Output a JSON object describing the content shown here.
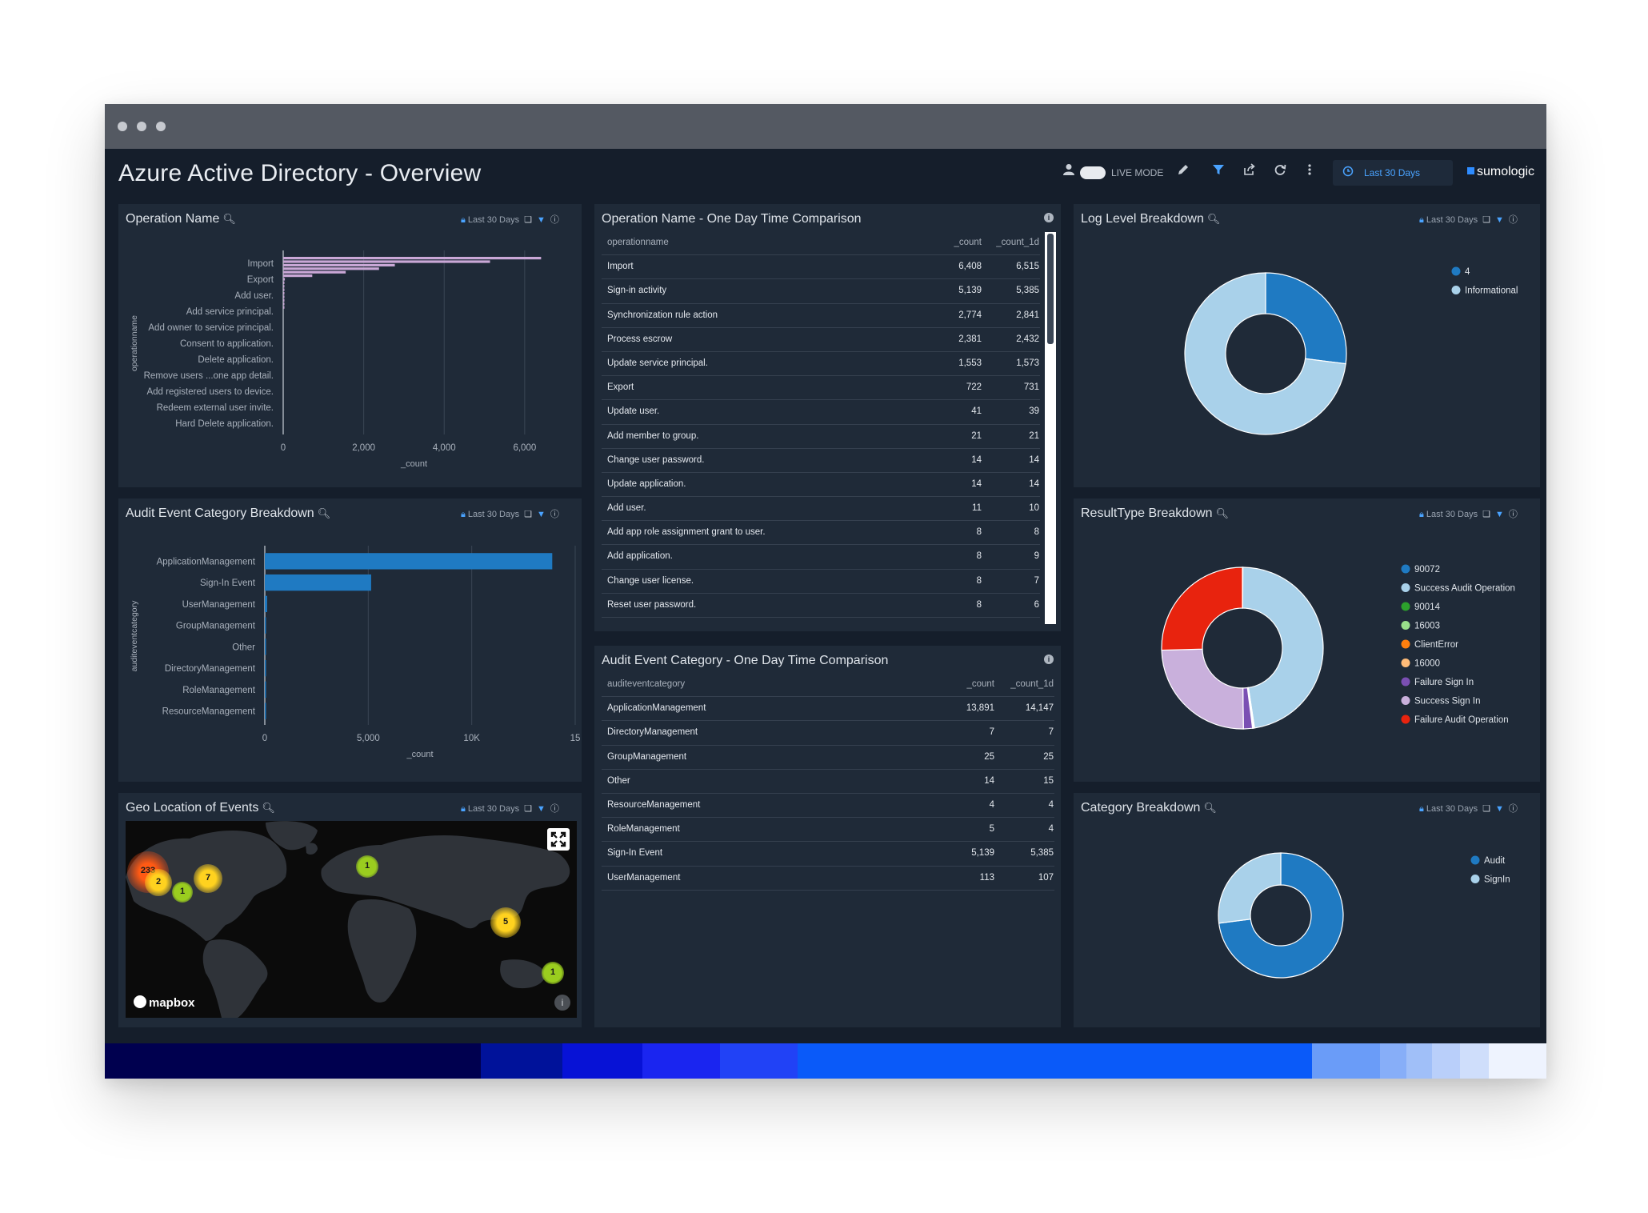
{
  "header": {
    "title": "Azure Active Directory - Overview",
    "live_mode_label": "LIVE MODE",
    "time_range": "Last 30 Days",
    "brand": "sumologic"
  },
  "panels": {
    "operation_name": {
      "title": "Operation Name",
      "time_range": "Last 30 Days",
      "chart_data": {
        "type": "bar",
        "orientation": "horizontal",
        "categories": [
          "Import",
          "Export",
          "Add user.",
          "Add service principal.",
          "Add owner to service principal.",
          "Consent to application.",
          "Delete application.",
          "Remove users ...one app detail.",
          "Add registered users to device.",
          "Redeem external user invite.",
          "Hard Delete application."
        ],
        "xlabel": "_count",
        "ylabel": "operationname",
        "xticks": [
          "0",
          "2,000",
          "4,000",
          "6,000"
        ],
        "xlim": [
          0,
          6500
        ],
        "bar_values": [
          6408,
          5139,
          2774,
          2381,
          1553,
          722,
          41,
          21,
          14,
          14,
          11,
          8,
          8,
          8,
          8
        ]
      }
    },
    "audit_category": {
      "title": "Audit Event Category Breakdown",
      "time_range": "Last 30 Days",
      "chart_data": {
        "type": "bar",
        "orientation": "horizontal",
        "categories": [
          "ApplicationManagement",
          "Sign-In Event",
          "UserManagement",
          "GroupManagement",
          "Other",
          "DirectoryManagement",
          "RoleManagement",
          "ResourceManagement"
        ],
        "values": [
          13891,
          5139,
          113,
          25,
          14,
          7,
          5,
          4
        ],
        "xlabel": "_count",
        "ylabel": "auditeventcategory",
        "xticks": [
          "0",
          "5,000",
          "10K",
          "15"
        ],
        "xlim": [
          0,
          15000
        ]
      }
    },
    "geo": {
      "title": "Geo Location of Events",
      "time_range": "Last 30 Days",
      "map_attribution": "mapbox",
      "clusters": [
        {
          "label": "233",
          "kind": "red"
        },
        {
          "label": "2",
          "kind": "yellow"
        },
        {
          "label": "1",
          "kind": "green"
        },
        {
          "label": "7",
          "kind": "yellow"
        },
        {
          "label": "1",
          "kind": "green"
        },
        {
          "label": "5",
          "kind": "yellow"
        },
        {
          "label": "1",
          "kind": "green"
        }
      ]
    },
    "op_comparison": {
      "title": "Operation Name - One Day Time Comparison",
      "columns": [
        "operationname",
        "_count",
        "_count_1d"
      ],
      "rows": [
        [
          "Import",
          "6,408",
          "6,515"
        ],
        [
          "Sign-in activity",
          "5,139",
          "5,385"
        ],
        [
          "Synchronization rule action",
          "2,774",
          "2,841"
        ],
        [
          "Process escrow",
          "2,381",
          "2,432"
        ],
        [
          "Update service principal.",
          "1,553",
          "1,573"
        ],
        [
          "Export",
          "722",
          "731"
        ],
        [
          "Update user.",
          "41",
          "39"
        ],
        [
          "Add member to group.",
          "21",
          "21"
        ],
        [
          "Change user password.",
          "14",
          "14"
        ],
        [
          "Update application.",
          "14",
          "14"
        ],
        [
          "Add user.",
          "11",
          "10"
        ],
        [
          "Add app role assignment grant to user.",
          "8",
          "8"
        ],
        [
          "Add application.",
          "8",
          "9"
        ],
        [
          "Change user license.",
          "8",
          "7"
        ],
        [
          "Reset user password.",
          "8",
          "6"
        ]
      ]
    },
    "audit_comparison": {
      "title": "Audit Event Category - One Day Time Comparison",
      "columns": [
        "auditeventcategory",
        "_count",
        "_count_1d"
      ],
      "rows": [
        [
          "ApplicationManagement",
          "13,891",
          "14,147"
        ],
        [
          "DirectoryManagement",
          "7",
          "7"
        ],
        [
          "GroupManagement",
          "25",
          "25"
        ],
        [
          "Other",
          "14",
          "15"
        ],
        [
          "ResourceManagement",
          "4",
          "4"
        ],
        [
          "RoleManagement",
          "5",
          "4"
        ],
        [
          "Sign-In Event",
          "5,139",
          "5,385"
        ],
        [
          "UserManagement",
          "113",
          "107"
        ]
      ]
    },
    "log_level": {
      "title": "Log Level Breakdown",
      "time_range": "Last 30 Days",
      "chart_data": {
        "type": "pie",
        "donut": true,
        "legend_position": "top-right",
        "labels": [
          "4",
          "Informational"
        ],
        "values": [
          27,
          73
        ],
        "colors": [
          "#1f7ac2",
          "#a9d1ea"
        ]
      }
    },
    "result_type": {
      "title": "ResultType Breakdown",
      "time_range": "Last 30 Days",
      "chart_data": {
        "type": "pie",
        "donut": true,
        "legend_position": "right",
        "labels": [
          "90072",
          "Success Audit Operation",
          "90014",
          "16003",
          "ClientError",
          "16000",
          "Failure Sign In",
          "Success Sign In",
          "Failure Audit Operation"
        ],
        "values": [
          0.1,
          47.5,
          0.1,
          0.1,
          0.1,
          0.1,
          1.8,
          24.8,
          25.4
        ],
        "colors": [
          "#1f7ac2",
          "#a9d1ea",
          "#2ca02c",
          "#98df8a",
          "#ff7f0e",
          "#ffbb78",
          "#7a4fb3",
          "#c9b0dc",
          "#e8230e"
        ]
      }
    },
    "category": {
      "title": "Category Breakdown",
      "time_range": "Last 30 Days",
      "chart_data": {
        "type": "pie",
        "donut": true,
        "legend_position": "top-right",
        "labels": [
          "Audit",
          "SignIn"
        ],
        "values": [
          73,
          27
        ],
        "colors": [
          "#1f7ac2",
          "#a9d1ea"
        ]
      }
    }
  },
  "colors": {
    "background": "#151e2b",
    "panel": "#1f2a38",
    "accent": "#4aa3ff",
    "bar_blue": "#1f7ac2",
    "bar_lilac": "#c9a7d6"
  }
}
